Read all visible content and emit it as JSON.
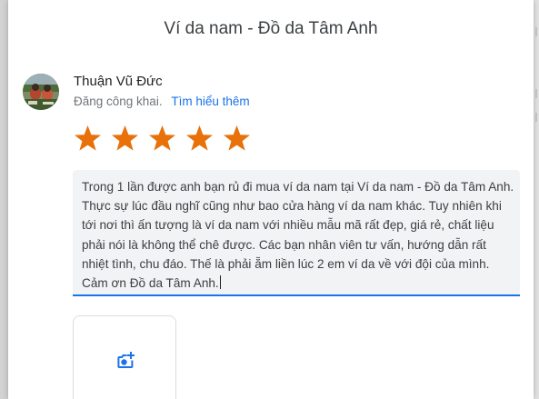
{
  "dialog": {
    "title": "Ví da nam - Đồ da Tâm Anh"
  },
  "user": {
    "name": "Thuận Vũ Đức",
    "visibility": "Đăng công khai.",
    "learn_more": "Tìm hiểu thêm"
  },
  "rating": {
    "value": 5,
    "max": 5,
    "star_color": "#e8710a"
  },
  "review": {
    "text": "Trong 1 lần được anh bạn rủ đi mua ví da nam tại Ví da nam - Đồ da Tâm Anh. Thực sự lúc đầu nghĩ cũng như bao cửa hàng ví da nam khác. Tuy nhiên khi tới nơi thì ấn tượng là ví da nam với nhiều mẫu mã rất đẹp, giá rẻ, chất liệu phải nói là không thể chê được. Các bạn nhân viên tư vấn, hướng dẫn rất nhiệt tình, chu đáo. Thế là phải ẵm liền lúc 2 em ví da về với đội của mình. Cảm ơn Đồ da Tâm Anh."
  },
  "photo": {
    "icon": "add-photo-icon",
    "color": "#1a73e8"
  },
  "colors": {
    "accent": "#1a73e8",
    "star": "#e8710a"
  }
}
